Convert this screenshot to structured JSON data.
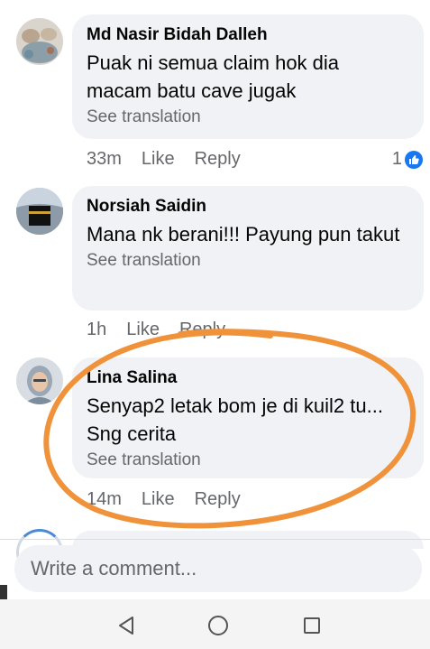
{
  "comments": [
    {
      "author": "Md Nasir Bidah Dalleh",
      "text": "Puak ni semua claim hok dia macam batu cave jugak",
      "translate": "See translation",
      "time": "33m",
      "like": "Like",
      "reply": "Reply",
      "reaction_count": "1",
      "reaction_icon": "like-reaction-icon"
    },
    {
      "author": "Norsiah Saidin",
      "text": "Mana nk berani!!! Payung pun takut",
      "translate": "See translation",
      "time": "1h",
      "like": "Like",
      "reply": "Reply"
    },
    {
      "author": "Lina Salina",
      "text": "Senyap2 letak bom je di kuil2 tu... Sng cerita",
      "translate": "See translation",
      "time": "14m",
      "like": "Like",
      "reply": "Reply"
    }
  ],
  "composer": {
    "placeholder": "Write a comment..."
  },
  "navbar": {
    "back_icon": "back-triangle-icon",
    "home_icon": "home-circle-icon",
    "recents_icon": "recents-square-icon"
  },
  "colors": {
    "bubble": "#f0f2f5",
    "meta_text": "#65676b",
    "like_blue": "#1877f2",
    "annotation_orange": "#f0923a"
  }
}
